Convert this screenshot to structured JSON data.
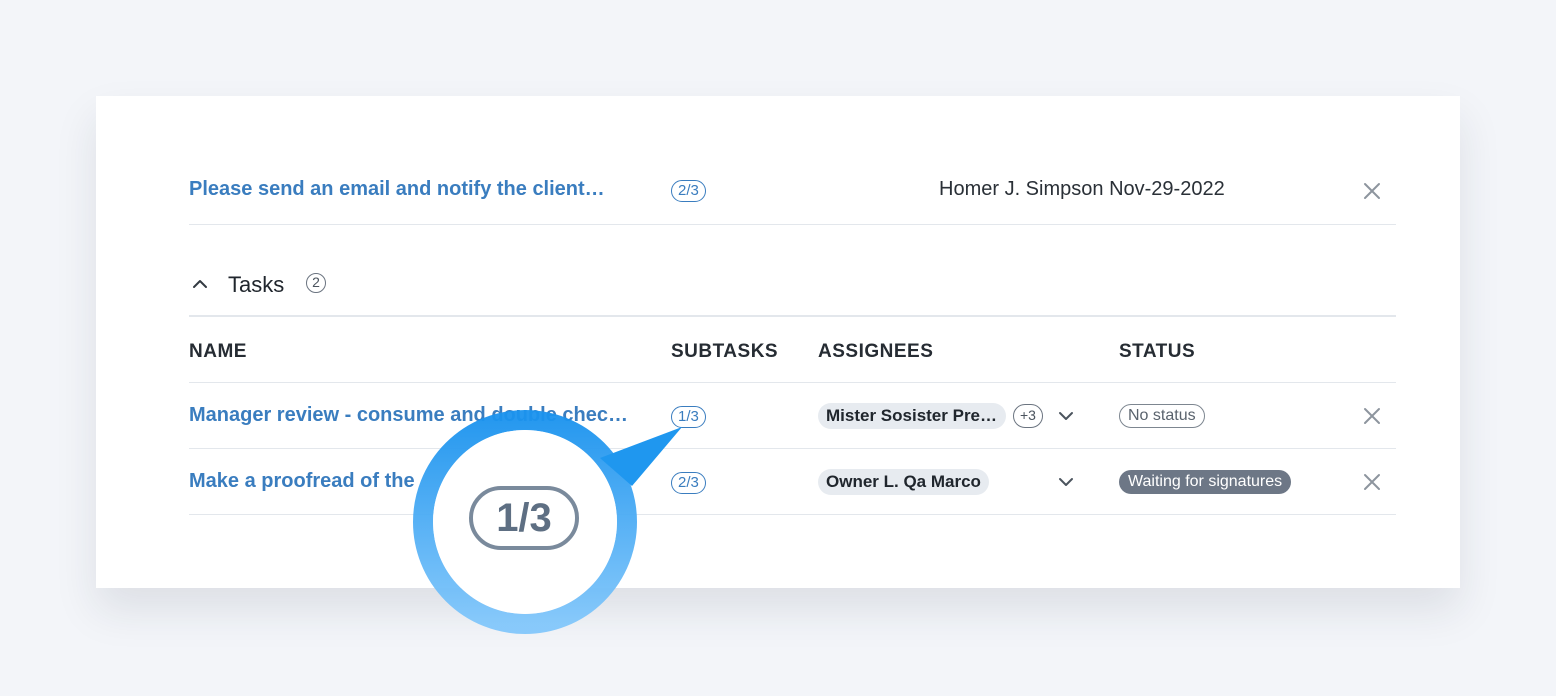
{
  "top_row": {
    "name": "Please send an email and notify the client…",
    "subtasks": "2/3",
    "assignee": "Homer J. Simpson",
    "date": "Nov-29-2022"
  },
  "tasks_section": {
    "title": "Tasks",
    "count": "2"
  },
  "columns": {
    "name": "NAME",
    "subtasks": "SUBTASKS",
    "assignees": "ASSIGNEES",
    "status": "STATUS"
  },
  "rows": [
    {
      "name": "Manager review - consume and double chec…",
      "subtasks": "1/3",
      "assignee": "Mister Sosister Pre…",
      "extra_assignees": "+3",
      "status": "No status",
      "status_style": "outline"
    },
    {
      "name": "Make a proofread of the",
      "subtasks": "2/3",
      "assignee": "Owner L. Qa Marco",
      "extra_assignees": "",
      "status": "Waiting for signatures",
      "status_style": "filled"
    }
  ],
  "magnifier": {
    "label": "1/3"
  },
  "colors": {
    "accent": "#3a7dbf",
    "magnifier_ring": "#2a9cf0",
    "status_filled": "#6d7786"
  }
}
